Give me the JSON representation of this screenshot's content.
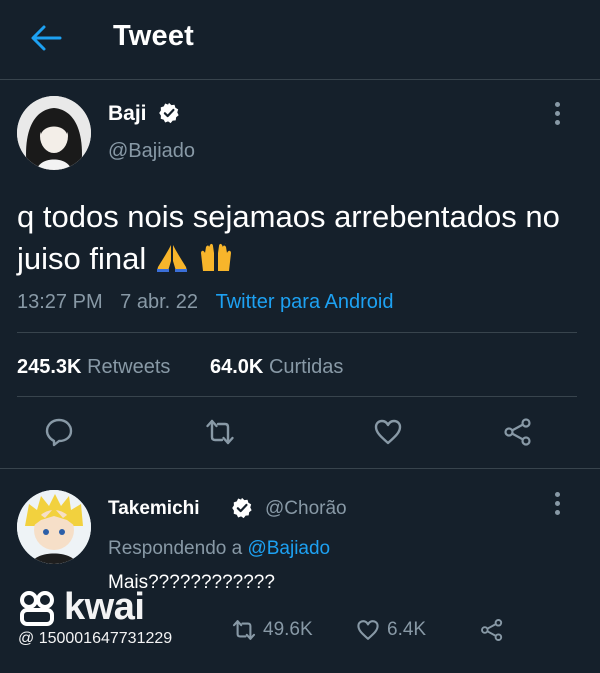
{
  "header": {
    "title": "Tweet"
  },
  "tweet": {
    "name": "Baji",
    "handle": "@Bajiado",
    "text": "q todos nois sejamaos arrebentados no juiso final",
    "time": "13:27 PM",
    "date": "7 abr. 22",
    "source": "Twitter para Android",
    "retweets_count": "245.3K",
    "retweets_label": "Retweets",
    "likes_count": "64.0K",
    "likes_label": "Curtidas"
  },
  "reply": {
    "name": "Takemichi",
    "handle": "@Chorão",
    "replying_prefix": "Respondendo a",
    "replying_to": "@Bajiado",
    "text": "Mais????????????",
    "retweets": "49.6K",
    "likes": "6.4K"
  },
  "watermark": {
    "brand": "kwai",
    "id": "@ 150001647731229"
  },
  "colors": {
    "background": "#15202b",
    "accent": "#1da1f2",
    "muted": "#8899a6",
    "divider": "#38444d"
  },
  "icons": [
    "back-arrow-icon",
    "verified-badge-icon",
    "more-vertical-icon",
    "reply-icon",
    "retweet-icon",
    "like-icon",
    "share-icon",
    "folded-hands-emoji",
    "raising-hands-emoji",
    "kwai-logo-icon"
  ]
}
